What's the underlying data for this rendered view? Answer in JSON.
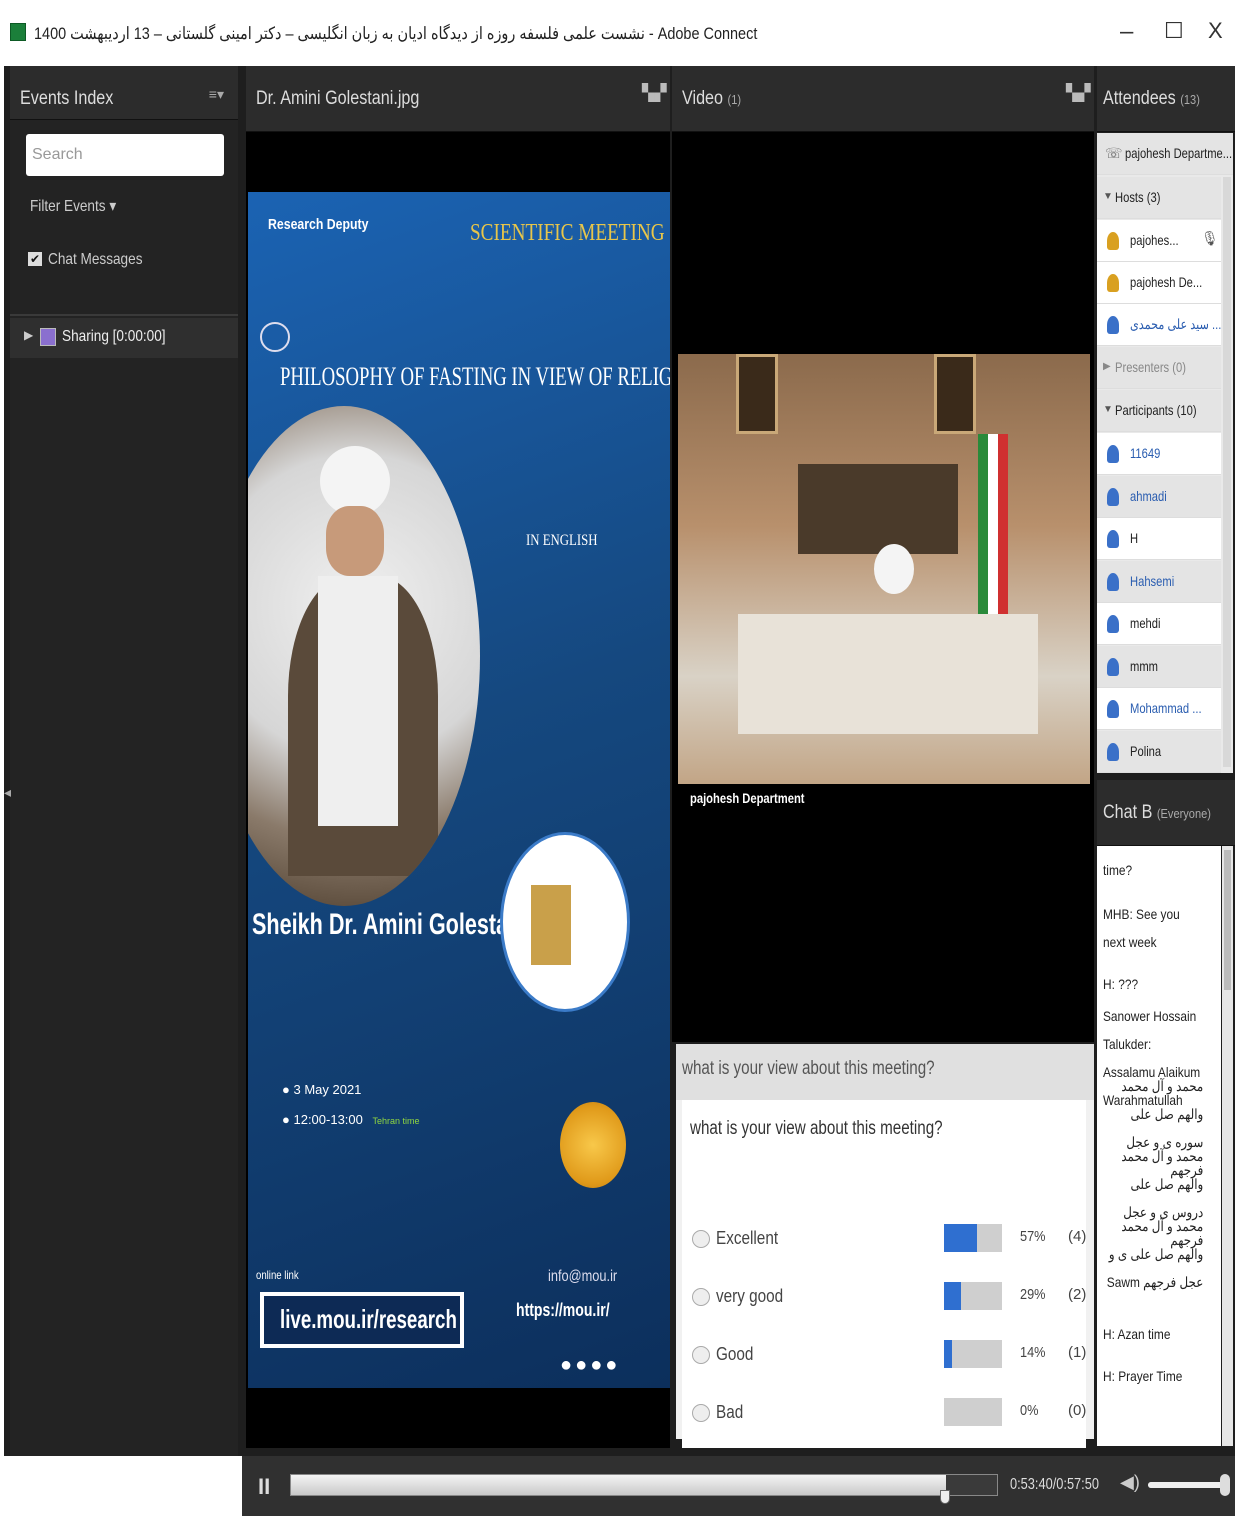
{
  "window": {
    "title": "1400 نشست علمی فلسفه روزه از دیدگاه ادیان به زبان انگلیسی – دکتر امینی گلستانی – 13 اردیبهشت - Adobe Connect",
    "minimize": "–",
    "maximize": "☐",
    "close": "X"
  },
  "events": {
    "title": "Events Index",
    "search_placeholder": "Search",
    "filter": "Filter Events ▾",
    "chat_messages": "Chat Messages",
    "sharing": "Sharing [0:00:00]"
  },
  "share": {
    "title": "Dr. Amini Golestani.jpg"
  },
  "poster": {
    "research_deputy": "Research Deputy",
    "meeting": "SCIENTIFIC MEETING",
    "topic": "PHILOSOPHY OF FASTING IN VIEW OF RELIGIONS",
    "in_english": "IN ENGLISH",
    "speaker": "Sheikh Dr. Amini Golestani",
    "date": "3 May 2021",
    "time": "12:00-13:00",
    "tz": "Tehran time",
    "online_link": "online link",
    "link": "live.mou.ir/research",
    "email": "info@mou.ir",
    "site": "https://mou.ir/"
  },
  "video": {
    "title": "Video",
    "count": "(1)",
    "caption": "pajohesh Department"
  },
  "attendees": {
    "title": "Attendees",
    "count": "(13)",
    "top": "pajohesh Departme...",
    "hosts": "Hosts (3)",
    "host_list": [
      "pajohes...",
      "pajohesh De...",
      "سید علی محمدی ..."
    ],
    "presenters": "Presenters (0)",
    "participants": "Participants (10)",
    "participant_list": [
      "11649",
      "ahmadi",
      "H",
      "Hahsemi",
      "mehdi",
      "mmm",
      "Mohammad ...",
      "Polina"
    ]
  },
  "chat": {
    "title": "Chat B",
    "scope": "(Everyone)",
    "messages": [
      "time?",
      "MHB: See you next week",
      "H: ???",
      "Sanower Hossain Talukder: Assalamu Alaikum Warahmatullah",
      "محمد و آل محمد والهم صل علی سوره ی و عجل فرجهم",
      "محمد و آل محمد والهم صل علی دروس ی و عجل فرجهم",
      "محمد و آل محمد والهم صل علی ی و عجل فرجهم Sawm",
      "H: Azan time",
      "H: Prayer Time"
    ]
  },
  "poll": {
    "header": "what is your view about this meeting?",
    "question": "what is your view about this meeting?",
    "options": [
      {
        "label": "Excellent",
        "percent": "57%",
        "count": "(4)",
        "fraction": 0.57
      },
      {
        "label": "very good",
        "percent": "29%",
        "count": "(2)",
        "fraction": 0.29
      },
      {
        "label": "Good",
        "percent": "14%",
        "count": "(1)",
        "fraction": 0.14
      },
      {
        "label": "Bad",
        "percent": "0%",
        "count": "(0)",
        "fraction": 0
      }
    ]
  },
  "playback": {
    "pause": "II",
    "time": "0:53:40/0:57:50",
    "progress": 0.928,
    "volume": 1.0
  },
  "colors": {
    "progress_fill": "#2f6fd0",
    "poster_bg": "#1a4f8f"
  }
}
